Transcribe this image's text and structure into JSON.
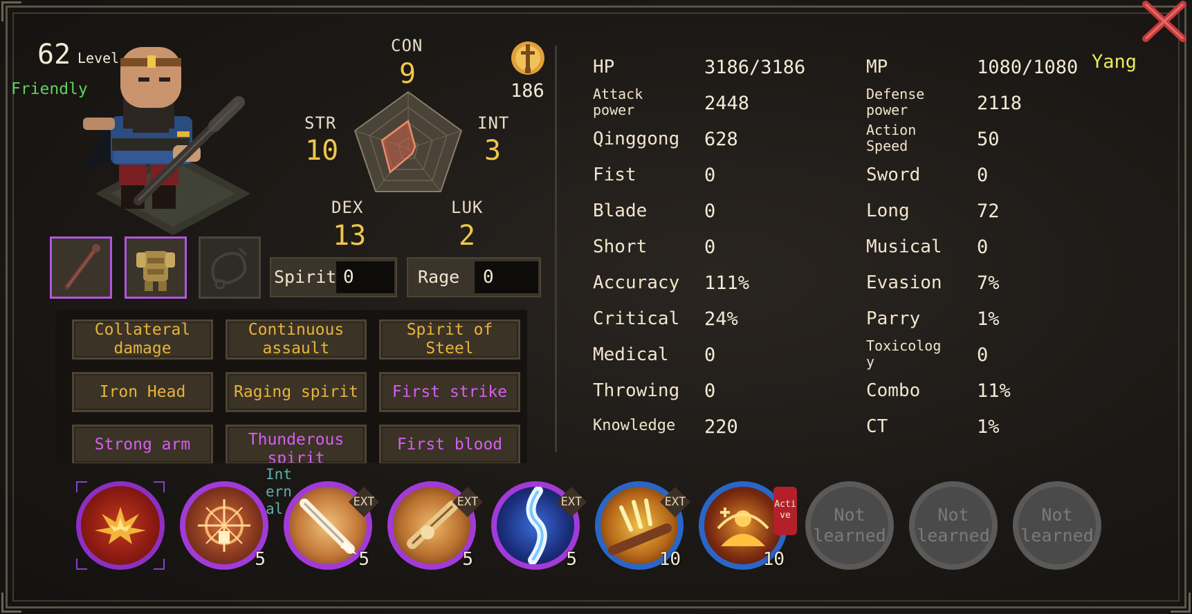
{
  "character": {
    "level_value": "62",
    "level_label": "Level",
    "attitude": "Friendly",
    "name": "Yang",
    "points_value": "186"
  },
  "attributes": {
    "con": {
      "label": "CON",
      "value": "9"
    },
    "str": {
      "label": "STR",
      "value": "10"
    },
    "int": {
      "label": "INT",
      "value": "3"
    },
    "dex": {
      "label": "DEX",
      "value": "13"
    },
    "luk": {
      "label": "LUK",
      "value": "2"
    }
  },
  "resources": {
    "spirit_label": "Spirit",
    "spirit_value": "0",
    "rage_label": "Rage",
    "rage_value": "0"
  },
  "traits": [
    {
      "label": "Collateral damage",
      "color": "gold"
    },
    {
      "label": "Continuous assault",
      "color": "gold"
    },
    {
      "label": "Spirit of Steel",
      "color": "gold"
    },
    {
      "label": "Iron Head",
      "color": "gold"
    },
    {
      "label": "Raging spirit",
      "color": "gold"
    },
    {
      "label": "First strike",
      "color": "purple"
    },
    {
      "label": "Strong arm",
      "color": "purple"
    },
    {
      "label": "Thunderous spirit",
      "color": "purple"
    },
    {
      "label": "First blood",
      "color": "purple"
    }
  ],
  "stats_left": [
    {
      "label": "HP",
      "value": "3186/3186"
    },
    {
      "label": "Attack power",
      "value": "2448"
    },
    {
      "label": "Qinggong",
      "value": "628"
    },
    {
      "label": "Fist",
      "value": "0"
    },
    {
      "label": "Blade",
      "value": "0"
    },
    {
      "label": "Short",
      "value": "0"
    },
    {
      "label": "Accuracy",
      "value": "111%"
    },
    {
      "label": "Critical",
      "value": "24%"
    },
    {
      "label": "Medical",
      "value": "0"
    },
    {
      "label": "Throwing",
      "value": "0"
    },
    {
      "label": "Knowledge",
      "value": "220"
    }
  ],
  "stats_right": [
    {
      "label": "MP",
      "value": "1080/1080"
    },
    {
      "label": "Defense power",
      "value": "2118"
    },
    {
      "label": "Action Speed",
      "value": "50"
    },
    {
      "label": "Sword",
      "value": "0"
    },
    {
      "label": "Long",
      "value": "72"
    },
    {
      "label": "Musical",
      "value": "0"
    },
    {
      "label": "Evasion",
      "value": "7%"
    },
    {
      "label": "Parry",
      "value": "1%"
    },
    {
      "label": "Toxicology",
      "value": "0"
    },
    {
      "label": "Combo",
      "value": "11%"
    },
    {
      "label": "CT",
      "value": "1%"
    }
  ],
  "skills": [
    {
      "level": "",
      "badge": ""
    },
    {
      "level": "5",
      "badge": "Internal"
    },
    {
      "level": "5",
      "badge": "EXT"
    },
    {
      "level": "5",
      "badge": "EXT"
    },
    {
      "level": "5",
      "badge": "EXT"
    },
    {
      "level": "10",
      "badge": "EXT"
    },
    {
      "level": "10",
      "badge": "Active"
    }
  ],
  "not_learned_label": "Not learned",
  "colors": {
    "gold": "#f0c64a",
    "purple": "#d65ff2",
    "panel": "#1a1714",
    "border": "#5a5347"
  }
}
